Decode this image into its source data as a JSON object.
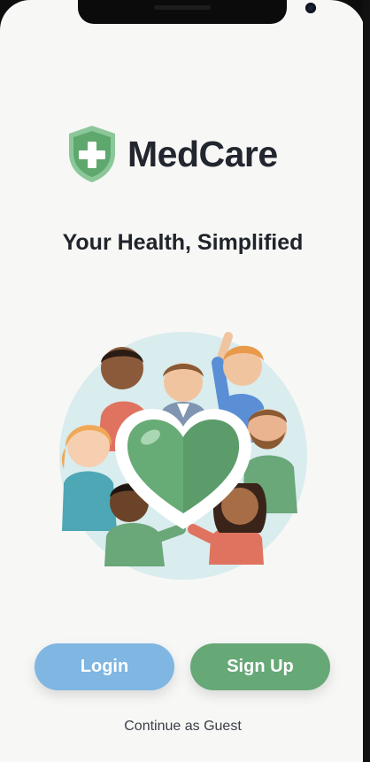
{
  "app": {
    "name": "MedCare",
    "tagline": "Your Health, Simplified"
  },
  "icons": {
    "logo": "shield-cross-icon",
    "hero": "heart-community-illustration"
  },
  "actions": {
    "login_label": "Login",
    "signup_label": "Sign Up",
    "guest_label": "Continue as Guest"
  },
  "colors": {
    "login": "#7fb6e2",
    "signup": "#67a877",
    "brand_green": "#5fa870",
    "text": "#22262e"
  }
}
